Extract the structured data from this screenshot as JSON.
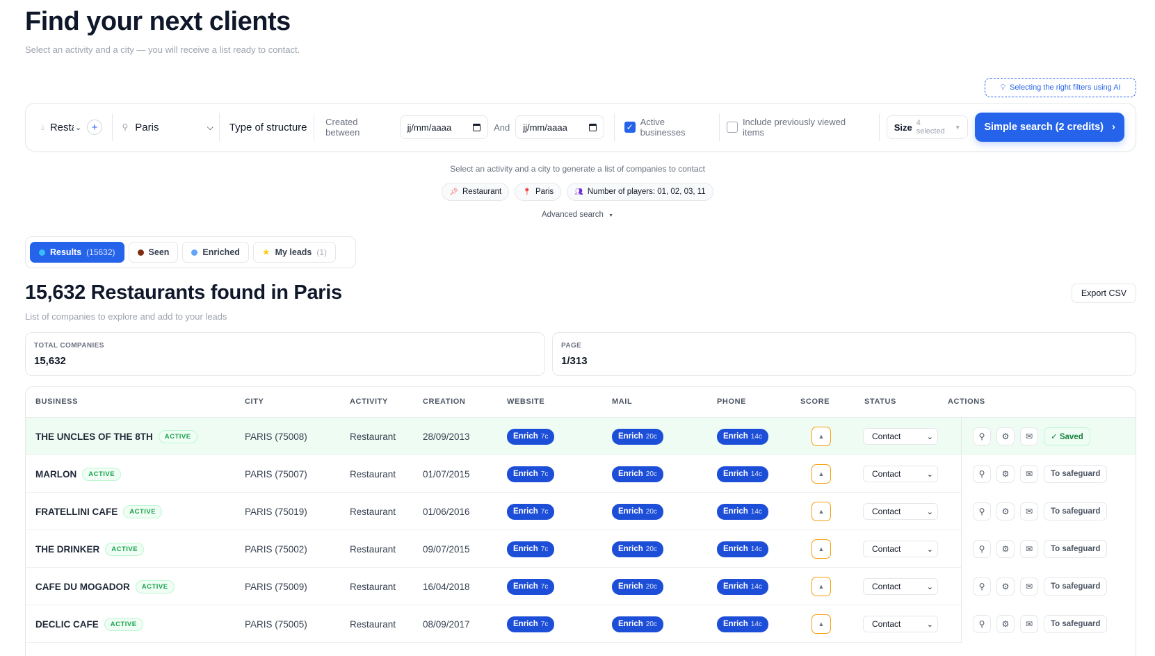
{
  "header": {
    "title": "Find your next clients",
    "subtitle": "Select an activity and a city — you will receive a list ready to contact."
  },
  "ai_button": {
    "label": "Selecting the right filters using AI",
    "icon": "lightbulb-icon"
  },
  "filters": {
    "activity_value": "Restaurant",
    "city_value": "Paris",
    "structure_type": "Type of structure",
    "created_between_label": "Created between",
    "date_from_placeholder": "jj/mm/aaaa",
    "and_label": "And",
    "date_to_placeholder": "jj/mm/aaaa",
    "active_businesses_label": "Active businesses",
    "active_businesses_checked": true,
    "previously_viewed_label": "Include previously viewed items",
    "previously_viewed_checked": false,
    "size_label": "Size",
    "size_value": "4 selected",
    "search_button": "Simple search (2 credits)"
  },
  "hint": "Select an activity and a city to generate a list of companies to contact",
  "chips": [
    {
      "label": "Restaurant",
      "icon": "pin-icon"
    },
    {
      "label": "Paris",
      "icon": "location-pin-icon"
    },
    {
      "label": "Number of players: 01, 02, 03, 11",
      "icon": "people-icon"
    }
  ],
  "advanced_search": "Advanced search",
  "tabs": [
    {
      "label": "Results",
      "count": "(15632)",
      "color": "#38bdf8"
    },
    {
      "label": "Seen",
      "count": "",
      "color": "#7c2d12"
    },
    {
      "label": "Enriched",
      "count": "",
      "color": "#60a5fa"
    },
    {
      "label": "My leads",
      "count": "(1)",
      "color": "#facc15"
    }
  ],
  "results": {
    "title": "15,632 Restaurants found in Paris",
    "subtitle": "List of companies to explore and add to your leads",
    "export_button": "Export CSV"
  },
  "stats": {
    "total_label": "TOTAL COMPANIES",
    "total_value": "15,632",
    "page_label": "PAGE",
    "page_value": "1/313"
  },
  "table": {
    "columns": [
      "BUSINESS",
      "CITY",
      "ACTIVITY",
      "CREATION",
      "WEBSITE",
      "MAIL",
      "PHONE",
      "SCORE",
      "STATUS",
      "ACTIONS"
    ],
    "enrich_label": "Enrich",
    "website_cost": "7c",
    "mail_cost": "20c",
    "phone_cost": "14c",
    "active_badge": "ACTIVE",
    "rows": [
      {
        "business": "THE UNCLES OF THE 8TH",
        "city": "PARIS (75008)",
        "activity": "Restaurant",
        "creation": "28/09/2013",
        "status": "Contact",
        "save": "✓ Saved",
        "saved": true
      },
      {
        "business": "MARLON",
        "city": "PARIS (75007)",
        "activity": "Restaurant",
        "creation": "01/07/2015",
        "status": "Contact",
        "save": "To safeguard",
        "saved": false
      },
      {
        "business": "FRATELLINI CAFE",
        "city": "PARIS (75019)",
        "activity": "Restaurant",
        "creation": "01/06/2016",
        "status": "Contact",
        "save": "To safeguard",
        "saved": false
      },
      {
        "business": "THE DRINKER",
        "city": "PARIS (75002)",
        "activity": "Restaurant",
        "creation": "09/07/2015",
        "status": "Contact",
        "save": "To safeguard",
        "saved": false
      },
      {
        "business": "CAFE DU MOGADOR",
        "city": "PARIS (75009)",
        "activity": "Restaurant",
        "creation": "16/04/2018",
        "status": "Contact",
        "save": "To safeguard",
        "saved": false
      },
      {
        "business": "DECLIC CAFE",
        "city": "PARIS (75005)",
        "activity": "Restaurant",
        "creation": "08/09/2017",
        "status": "Contact",
        "save": "To safeguard",
        "saved": false
      }
    ]
  }
}
